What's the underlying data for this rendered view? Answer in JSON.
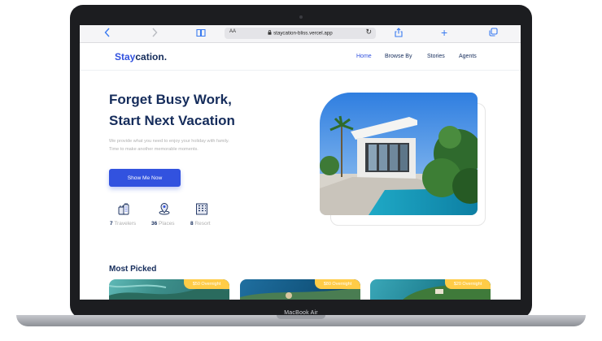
{
  "browser": {
    "url": "staycation-bliss.vercel.app",
    "text_size_label": "AA",
    "icons": [
      "back-icon",
      "forward-icon",
      "book-icon",
      "lock-icon",
      "reload-icon",
      "share-icon",
      "plus-icon",
      "tabs-icon"
    ]
  },
  "site": {
    "brand_part1": "Stay",
    "brand_part2": "cation.",
    "nav": [
      "Home",
      "Browse By",
      "Stories",
      "Agents"
    ],
    "active_nav": "Home"
  },
  "hero": {
    "title_line1": "Forget Busy Work,",
    "title_line2": "Start Next Vacation",
    "description": "We provide what you need to enjoy your holiday with family. Time to make another memorable moments.",
    "cta": "Show Me Now"
  },
  "stats": [
    {
      "value": "7",
      "label": "Travelers",
      "icon": "traveler-icon"
    },
    {
      "value": "36",
      "label": "Places",
      "icon": "location-icon"
    },
    {
      "value": "8",
      "label": "Resort",
      "icon": "building-icon"
    }
  ],
  "most_picked": {
    "title": "Most Picked",
    "cards": [
      {
        "price": "$50 Overnight"
      },
      {
        "price": "$80 Overnight"
      },
      {
        "price": "$20 Overnight"
      }
    ]
  },
  "device_label": "MacBook Air",
  "colors": {
    "primary": "#3252df",
    "navy": "#152c5b",
    "badge": "#ffcc47",
    "muted": "#b0b0b0"
  }
}
